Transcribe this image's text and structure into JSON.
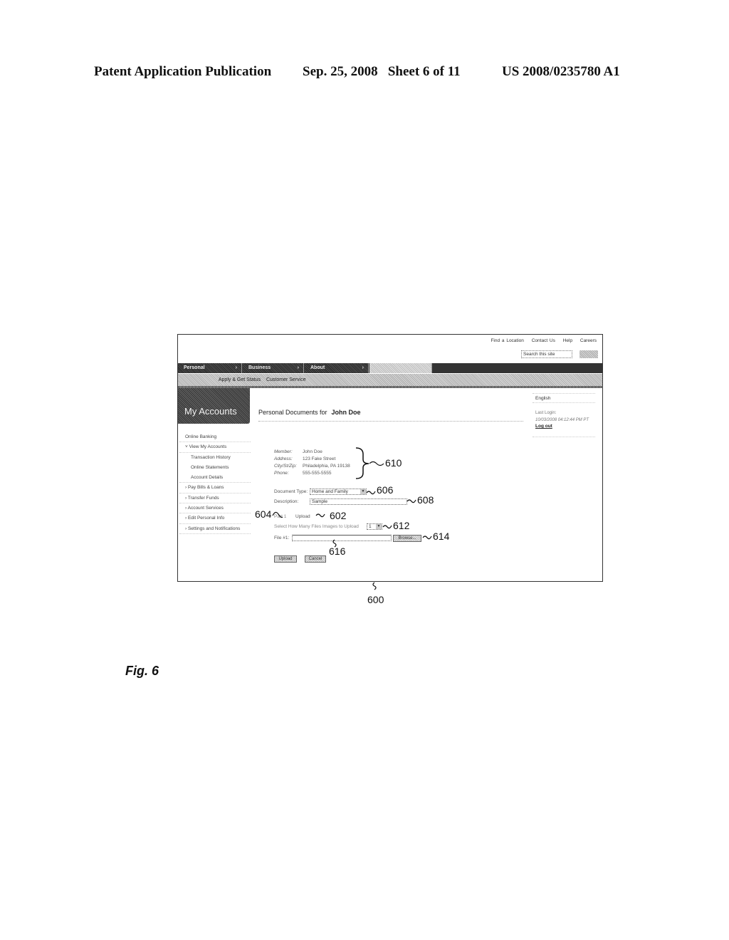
{
  "page_header": {
    "publication": "Patent Application Publication",
    "date_sheet": "Sep. 25, 2008   Sheet 6 of 11",
    "number": "US 2008/0235780 A1"
  },
  "ui": {
    "top_links": [
      "Find a Location",
      "Contact Us",
      "Help",
      "Careers"
    ],
    "search_placeholder": "Search this site",
    "nav_tabs": [
      {
        "label": "Personal",
        "chevron": "›"
      },
      {
        "label": "Business",
        "chevron": "›"
      },
      {
        "label": "About",
        "chevron": "›"
      },
      {
        "label": "",
        "chevron": ""
      }
    ],
    "subnav": [
      "",
      "Apply & Get Status",
      "Customer Service"
    ],
    "section_title": "My Accounts",
    "sidebar": [
      {
        "label": "Online Banking",
        "sub": false
      },
      {
        "label": "˅ View My Accounts",
        "sub": false
      },
      {
        "label": "Transaction History",
        "sub": true
      },
      {
        "label": "Online Statements",
        "sub": true
      },
      {
        "label": "Account Details",
        "sub": true
      },
      {
        "label": "› Pay Bills & Loans",
        "sub": false
      },
      {
        "label": "› Transfer Funds",
        "sub": false
      },
      {
        "label": "› Account Services",
        "sub": false
      },
      {
        "label": "› Edit Personal Info",
        "sub": false
      },
      {
        "label": "› Settings and Notifications",
        "sub": false
      }
    ],
    "page_title": "Personal Documents for",
    "user_name": "John Doe",
    "language": "English",
    "last_login_label": "Last Login:",
    "last_login_value": "10/03/2008 04:12:44 PM PT",
    "logout": "Log out",
    "member_info": [
      {
        "label": "Member:",
        "value": "John Doe"
      },
      {
        "label": "Address:",
        "value": "123 Fake Street"
      },
      {
        "label": "City/St/Zip:",
        "value": "Philadelphia, PA 19138"
      },
      {
        "label": "Phone:",
        "value": "555-555-5555"
      }
    ],
    "document_type_label": "Document Type:",
    "document_type_value": "Home and Family",
    "description_label": "Description:",
    "description_value": "Sample",
    "part_label": "Part 1",
    "upload_label": "Upload",
    "files_count_label": "Select How Many Files Images to Upload",
    "files_count_value": "1",
    "file_label": "File #1:",
    "file_value": "",
    "browse_label": "Browse...",
    "upload_button": "Upload",
    "cancel_button": "Cancel"
  },
  "reference_numerals": {
    "r600": "600",
    "r602": "602",
    "r604": "604",
    "r606": "606",
    "r608": "608",
    "r610": "610",
    "r612": "612",
    "r614": "614",
    "r616": "616"
  },
  "figure_label": "Fig. 6"
}
